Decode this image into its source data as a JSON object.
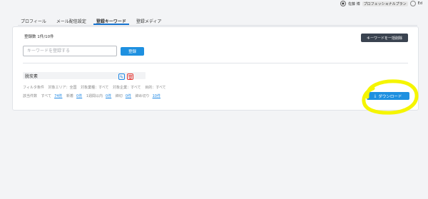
{
  "header": {
    "user_name": "佐藤 博",
    "plan_badge": "プロフェッショナルプラン",
    "user_suffix": "Ed"
  },
  "tabs": [
    {
      "label": "プロフィール",
      "active": false
    },
    {
      "label": "メール配信設定",
      "active": false
    },
    {
      "label": "登録キーワード",
      "active": true
    },
    {
      "label": "登録メディア",
      "active": false
    }
  ],
  "keywords": {
    "count_text": "登録数 1件/10件",
    "input_placeholder": "キーワードを登録する",
    "register_label": "登録",
    "bulk_delete_label": "キーワードを一括削除",
    "item": {
      "label": "脱炭素",
      "filters": [
        "フィルタ条件",
        "対象エリア：全国",
        "対象業種：すべて",
        "対象企業：すべて",
        "目的：すべて"
      ],
      "stats_label": "該当件数",
      "stats": [
        {
          "prefix": "すべて",
          "value": "74件"
        },
        {
          "prefix": "新着",
          "value": "0件"
        },
        {
          "prefix": "1週間以内",
          "value": "0件"
        },
        {
          "prefix": "締切",
          "value": "0件"
        },
        {
          "prefix": "締め切り",
          "value": "10件"
        }
      ]
    },
    "download_label": "ダウンロード"
  },
  "colors": {
    "accent": "#1e90e0",
    "dark_button": "#3a4350",
    "highlight": "#f5f500"
  }
}
